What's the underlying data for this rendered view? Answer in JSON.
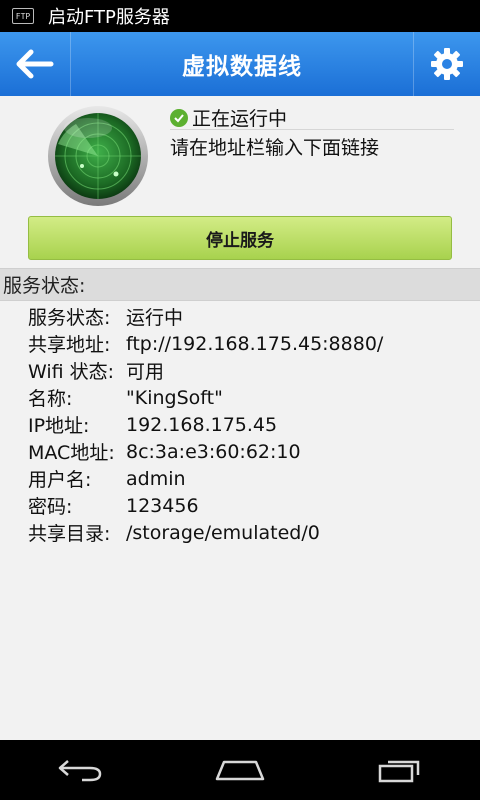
{
  "status_bar": {
    "app_icon": "ftp-icon",
    "icon_text": "FTP",
    "title": "启动FTP服务器"
  },
  "app_bar": {
    "title": "虚拟数据线",
    "back_icon": "back-arrow-icon",
    "settings_icon": "gear-icon"
  },
  "server": {
    "status_text": "正在运行中",
    "hint": "请在地址栏输入下面链接",
    "stop_button": "停止服务"
  },
  "details": {
    "header": "服务状态:",
    "rows": [
      {
        "label": "服务状态:",
        "value": "运行中"
      },
      {
        "label": "共享地址:",
        "value": "ftp://192.168.175.45:8880/"
      },
      {
        "label": "Wifi 状态:",
        "value": "可用"
      },
      {
        "label": "名称:",
        "value": "\"KingSoft\""
      },
      {
        "label": "IP地址:",
        "value": "192.168.175.45"
      },
      {
        "label": "MAC地址:",
        "value": "8c:3a:e3:60:62:10"
      },
      {
        "label": "用户名:",
        "value": "admin"
      },
      {
        "label": "密码:",
        "value": "123456"
      },
      {
        "label": "共享目录:",
        "value": "/storage/emulated/0"
      }
    ]
  },
  "nav_bar": {
    "back": "nav-back-icon",
    "home": "nav-home-icon",
    "recents": "nav-recents-icon"
  },
  "colors": {
    "app_bar": "#2a82e4",
    "stop_button": "#bfe06a",
    "running_check": "#5cb030"
  }
}
